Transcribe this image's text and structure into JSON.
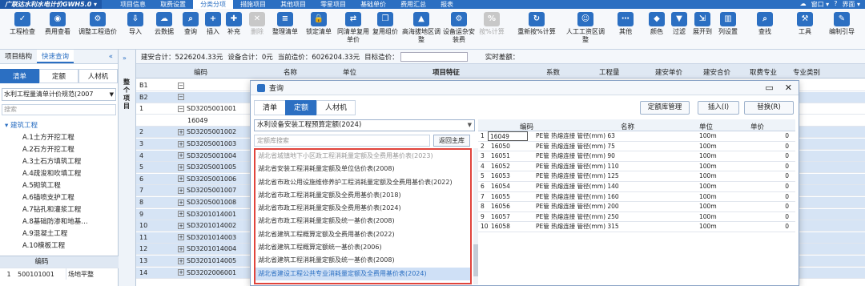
{
  "titlebar": {
    "app_name": "广联达水利水电计价GWH5.0 ▾",
    "menu": [
      "项目信息",
      "取费设置",
      "分类分项",
      "措施项目",
      "其他项目",
      "零星项目",
      "基础单价",
      "费用汇总",
      "报表"
    ],
    "active_menu": "分类分项",
    "right": [
      "☁",
      "窗口 ▾",
      "?",
      "界面 ▾"
    ]
  },
  "ribbon": {
    "buttons": [
      {
        "label": "工程检查",
        "icon": "check-icon",
        "color": "#2b6fc2",
        "enabled": true
      },
      {
        "label": "费用查看",
        "icon": "eye-icon",
        "color": "#2b6fc2",
        "enabled": true
      },
      {
        "label": "调整工程造价",
        "icon": "adjust-icon",
        "color": "#2b6fc2",
        "enabled": true
      },
      {
        "label": "导入",
        "icon": "import-icon",
        "color": "#2b6fc2",
        "enabled": true
      },
      {
        "label": "云数据",
        "icon": "cloud-icon",
        "color": "#2b6fc2",
        "enabled": true
      },
      {
        "label": "查询",
        "icon": "search-icon",
        "color": "#2b6fc2",
        "enabled": true
      },
      {
        "label": "插入",
        "icon": "insert-icon",
        "color": "#2b6fc2",
        "enabled": true
      },
      {
        "label": "补充",
        "icon": "supplement-icon",
        "color": "#2b6fc2",
        "enabled": true
      },
      {
        "label": "删除",
        "icon": "delete-icon",
        "color": "#c8c8c8",
        "enabled": false
      },
      {
        "label": "整理清单",
        "icon": "organize-icon",
        "color": "#2b6fc2",
        "enabled": true
      },
      {
        "label": "锁定清单",
        "icon": "lock-icon",
        "color": "#2b6fc2",
        "enabled": true
      },
      {
        "label": "同清单复用单价",
        "icon": "reuse-icon",
        "color": "#2b6fc2",
        "enabled": true
      },
      {
        "label": "复用组价",
        "icon": "copy-price-icon",
        "color": "#2b6fc2",
        "enabled": true
      },
      {
        "label": "高海拔地区调整",
        "icon": "altitude-icon",
        "color": "#2b6fc2",
        "enabled": true
      },
      {
        "label": "设备运杂安装费",
        "icon": "equipment-icon",
        "color": "#2b6fc2",
        "enabled": true
      },
      {
        "label": "按%计算",
        "icon": "percent-icon",
        "color": "#c8c8c8",
        "enabled": false
      },
      {
        "label": "重新按%计算",
        "icon": "recalc-icon",
        "color": "#2b6fc2",
        "enabled": true
      },
      {
        "label": "人工工资区调整",
        "icon": "wage-icon",
        "color": "#2b6fc2",
        "enabled": true
      },
      {
        "label": "其他",
        "icon": "other-icon",
        "color": "#2b6fc2",
        "enabled": true
      },
      {
        "label": "颜色",
        "icon": "color-icon",
        "color": "#2b6fc2",
        "enabled": true
      },
      {
        "label": "过滤",
        "icon": "filter-icon",
        "color": "#2b6fc2",
        "enabled": true
      },
      {
        "label": "展开到",
        "icon": "expand-icon",
        "color": "#2b6fc2",
        "enabled": true
      },
      {
        "label": "列设置",
        "icon": "columns-icon",
        "color": "#2b6fc2",
        "enabled": true
      },
      {
        "label": "查找",
        "icon": "find-icon",
        "color": "#2b6fc2",
        "enabled": true
      },
      {
        "label": "工具",
        "icon": "tools-icon",
        "color": "#2b6fc2",
        "enabled": true
      },
      {
        "label": "编制引导",
        "icon": "guide-icon",
        "color": "#2b6fc2",
        "enabled": true
      }
    ]
  },
  "left": {
    "tabs": [
      "项目结构",
      "快速查询"
    ],
    "subtabs": [
      "清单",
      "定额",
      "人材机"
    ],
    "spec": "水利工程量清单计价规范(2007",
    "search_placeholder": "搜索",
    "tree_root": "建筑工程",
    "tree_items": [
      "A.1土方开挖工程",
      "A.2石方开挖工程",
      "A.3土石方填筑工程",
      "A.4疏浚和吹填工程",
      "A.5砌筑工程",
      "A.6锚喷支护工程",
      "A.7钻孔和灌浆工程",
      "A.8基础防渗和地基…",
      "A.9混凝土工程",
      "A.10模板工程"
    ],
    "table_header": "编码",
    "table_row": {
      "num": "1",
      "code": "500101001",
      "name": "场地平整"
    }
  },
  "strip": {
    "label": "整个项目"
  },
  "info": {
    "build_total": "建安合计：5226204.33元",
    "equip_total": "设备合计：0元",
    "current_cost": "当前造价：6026204.33元",
    "target_cost": "目标造价：",
    "realtime": "实时差额："
  },
  "grid": {
    "headers": [
      "编码",
      "名称",
      "单位",
      "项目特征",
      "系数",
      "工程量",
      "建安单价",
      "建安合价",
      "取费专业",
      "专业类别"
    ],
    "rows": [
      {
        "rn": "B1",
        "code": "",
        "cls": "装"
      },
      {
        "rn": "B2",
        "code": "",
        "cls": "装"
      },
      {
        "rn": "1",
        "code": "SD3205001001",
        "cls": "装"
      },
      {
        "rn": "",
        "code": "16049",
        "cls": ""
      },
      {
        "rn": "2",
        "code": "SD3205001002",
        "cls": "装"
      },
      {
        "rn": "3",
        "code": "SD3205001003",
        "cls": "装"
      },
      {
        "rn": "4",
        "code": "SD3205001004",
        "cls": "装"
      },
      {
        "rn": "5",
        "code": "SD3205001005",
        "cls": "装"
      },
      {
        "rn": "6",
        "code": "SD3205001006",
        "cls": "装"
      },
      {
        "rn": "7",
        "code": "SD3205001007",
        "cls": "装"
      },
      {
        "rn": "8",
        "code": "SD3205001008",
        "cls": "装"
      },
      {
        "rn": "9",
        "code": "SD3201014001",
        "cls": "装"
      },
      {
        "rn": "10",
        "code": "SD3201014002",
        "cls": "装"
      },
      {
        "rn": "11",
        "code": "SD3201014003",
        "cls": "装"
      },
      {
        "rn": "12",
        "code": "SD3201014004",
        "cls": "装"
      },
      {
        "rn": "13",
        "code": "SD3201014005",
        "cls": "装"
      },
      {
        "rn": "14",
        "code": "SD3202006001",
        "cls": "装"
      }
    ]
  },
  "dialog": {
    "title": "查询",
    "tabs": [
      "清单",
      "定额",
      "人材机"
    ],
    "active_tab": "定额",
    "btn_manage": "定额库管理",
    "btn_insert": "插入(I)",
    "btn_replace": "替换(R)",
    "norm_select": "水利设备安装工程预算定额(2024)",
    "search_placeholder": "定额库搜索",
    "return_btn": "返回主库",
    "norm_list": [
      "湖北省城镇地下小区政工程消耗量定额及全费用基价表(2023)",
      "湖北省安装工程消耗量定额及单位估价表(2008)",
      "湖北省市政公用设施维修养护工程消耗量定额及全费用基价表(2022)",
      "湖北省市政工程消耗量定额及全费用基价表(2018)",
      "湖北省市政工程消耗量定额及全费用基价表(2024)",
      "湖北省市政工程消耗量定额及统一基价表(2008)",
      "湖北省建筑工程概算定额及全费用基价表(2022)",
      "湖北省建筑工程概算定额统一基价表(2006)",
      "湖北省建筑工程消耗量定额及统一基价表(2008)",
      "湖北省建设工程公共专业消耗量定额及全费用基价表(2024)"
    ],
    "result_headers": [
      "编码",
      "名称",
      "单位",
      "单价"
    ],
    "results": [
      {
        "n": "1",
        "code": "16049",
        "name": "PE管 热熔连接 管径(mm) 63",
        "unit": "100m",
        "price": "0"
      },
      {
        "n": "2",
        "code": "16050",
        "name": "PE管 热熔连接 管径(mm) 75",
        "unit": "100m",
        "price": "0"
      },
      {
        "n": "3",
        "code": "16051",
        "name": "PE管 热熔连接 管径(mm) 90",
        "unit": "100m",
        "price": "0"
      },
      {
        "n": "4",
        "code": "16052",
        "name": "PE管 热熔连接 管径(mm) 110",
        "unit": "100m",
        "price": "0"
      },
      {
        "n": "5",
        "code": "16053",
        "name": "PE管 热熔连接 管径(mm) 125",
        "unit": "100m",
        "price": "0"
      },
      {
        "n": "6",
        "code": "16054",
        "name": "PE管 热熔连接 管径(mm) 140",
        "unit": "100m",
        "price": "0"
      },
      {
        "n": "7",
        "code": "16055",
        "name": "PE管 热熔连接 管径(mm) 160",
        "unit": "100m",
        "price": "0"
      },
      {
        "n": "8",
        "code": "16056",
        "name": "PE管 热熔连接 管径(mm) 200",
        "unit": "100m",
        "price": "0"
      },
      {
        "n": "9",
        "code": "16057",
        "name": "PE管 热熔连接 管径(mm) 250",
        "unit": "100m",
        "price": "0"
      },
      {
        "n": "10",
        "code": "16058",
        "name": "PE管 热熔连接 管径(mm) 315",
        "unit": "100m",
        "price": "0"
      }
    ]
  }
}
